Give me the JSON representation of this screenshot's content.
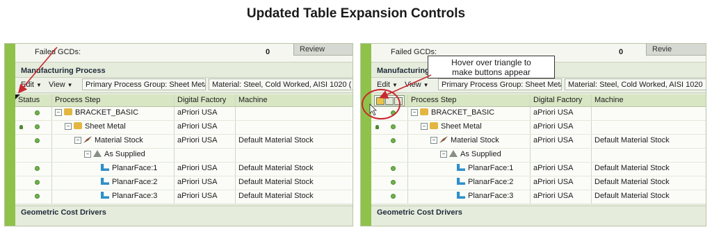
{
  "title": "Updated Table Expansion Controls",
  "callout": {
    "line1": "Hover over triangle to",
    "line2": "make buttons appear"
  },
  "colors": {
    "accent_green": "#8fc24a",
    "header_green": "#d9e6c4",
    "annotation_red": "#c8282e"
  },
  "left": {
    "failed_label": "Failed GCDs:",
    "failed_value": "0",
    "review_button": "Review",
    "section_mfg": "Manufacturing Process",
    "toolbar": {
      "edit": "Edit",
      "view": "View",
      "process_group": "Primary Process Group: Sheet Metal",
      "material": "Material: Steel, Cold Worked, AISI 1020 ("
    },
    "columns": [
      "Status",
      "Process Step",
      "Digital Factory",
      "Machine"
    ],
    "rows": [
      {
        "step": "BRACKET_BASIC",
        "df": "aPriori USA",
        "machine": ""
      },
      {
        "step": "Sheet Metal",
        "df": "aPriori USA",
        "machine": ""
      },
      {
        "step": "Material Stock",
        "df": "aPriori USA",
        "machine": "Default Material Stock"
      },
      {
        "step": "As Supplied",
        "df": "",
        "machine": ""
      },
      {
        "step": "PlanarFace:1",
        "df": "aPriori USA",
        "machine": "Default Material Stock"
      },
      {
        "step": "PlanarFace:2",
        "df": "aPriori USA",
        "machine": "Default Material Stock"
      },
      {
        "step": "PlanarFace:3",
        "df": "aPriori USA",
        "machine": "Default Material Stock"
      }
    ],
    "section_geo": "Geometric Cost Drivers"
  },
  "right": {
    "failed_label": "Failed GCDs:",
    "failed_value": "0",
    "review_button": "Revie",
    "section_mfg": "Manufacturing",
    "toolbar": {
      "edit": "Edit",
      "view": "View",
      "process_group": "Primary Process Group: Sheet Metal",
      "material": "Material: Steel, Cold Worked, AISI 1020"
    },
    "columns": [
      "",
      "Process Step",
      "Digital Factory",
      "Machine"
    ],
    "rows": [
      {
        "step": "BRACKET_BASIC",
        "df": "aPriori USA",
        "machine": ""
      },
      {
        "step": "Sheet Metal",
        "df": "aPriori USA",
        "machine": ""
      },
      {
        "step": "Material Stock",
        "df": "aPriori USA",
        "machine": "Default Material Stock"
      },
      {
        "step": "As Supplied",
        "df": "",
        "machine": ""
      },
      {
        "step": "PlanarFace:1",
        "df": "aPriori USA",
        "machine": "Default Material Stock"
      },
      {
        "step": "PlanarFace:2",
        "df": "aPriori USA",
        "machine": "Default Material Stock"
      },
      {
        "step": "PlanarFace:3",
        "df": "aPriori USA",
        "machine": "Default Material Stock"
      }
    ],
    "section_geo": "Geometric Cost Drivers"
  }
}
